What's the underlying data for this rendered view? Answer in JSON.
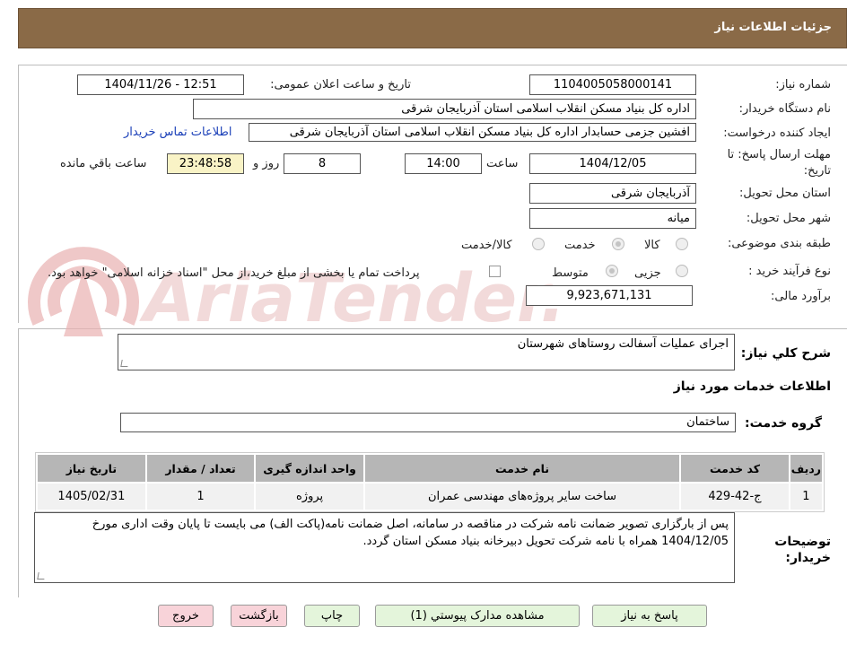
{
  "header": {
    "title": "جزئیات اطلاعات نیاز"
  },
  "watermark": {
    "text": "AriaTender.neT"
  },
  "form": {
    "need_number": {
      "label": "شماره نیاز:",
      "value": "1104005058000141"
    },
    "announce": {
      "label": "تاریخ و ساعت اعلان عمومی:",
      "value": "1404/11/26 - 12:51"
    },
    "buyer_org": {
      "label": "نام دستگاه خریدار:",
      "value": "اداره کل بنیاد مسکن انقلاب اسلامی استان آذربایجان شرقی"
    },
    "creator": {
      "label": "ایجاد کننده درخواست:",
      "value": "افشین جزمی حسابدار اداره کل بنیاد مسکن انقلاب اسلامی استان آذربایجان شرقی",
      "contact_link": "اطلاعات تماس خریدار"
    },
    "deadline": {
      "label_line1": "مهلت ارسال پاسخ: تا",
      "label_line2": "تاریخ:",
      "date": "1404/12/05",
      "time_label": "ساعت",
      "time": "14:00",
      "days": "8",
      "days_label": "روز و",
      "remaining": "23:48:58",
      "remaining_label": "ساعت باقي مانده"
    },
    "province": {
      "label": "استان محل تحویل:",
      "value": "آذربایجان شرقی"
    },
    "city": {
      "label": "شهر محل تحویل:",
      "value": "میانه"
    },
    "category": {
      "label": "طبقه بندی موضوعی:",
      "options": [
        {
          "label": "کالا",
          "selected": false
        },
        {
          "label": "خدمت",
          "selected": true
        },
        {
          "label": "کالا/خدمت",
          "selected": false
        }
      ]
    },
    "process": {
      "label": "نوع فرآیند خرید :",
      "options": [
        {
          "label": "جزیی",
          "selected": false
        },
        {
          "label": "متوسط",
          "selected": true
        }
      ],
      "note": "پرداخت تمام یا بخشی از مبلغ خرید،از محل \"اسناد خزانه اسلامی\" خواهد بود."
    },
    "budget": {
      "label": "برآورد مالی:",
      "value": "9,923,671,131"
    }
  },
  "description": {
    "label": "شرح کلي نياز:",
    "value": "اجرای عملیات آسفالت روستاهای شهرستان"
  },
  "services": {
    "title": "اطلاعات خدمات مورد نیاز",
    "group_label": "گروه خدمت:",
    "group_value": "ساختمان",
    "columns": [
      "ردیف",
      "کد خدمت",
      "نام خدمت",
      "واحد اندازه گیری",
      "تعداد / مقدار",
      "تاریخ نیاز"
    ],
    "rows": [
      [
        "1",
        "ج-42-429",
        "ساخت سایر پروژه‌های مهندسی عمران",
        "پروژه",
        "1",
        "1405/02/31"
      ]
    ]
  },
  "buyer_notes": {
    "label_line1": "توضیحات",
    "label_line2": "خریدار:",
    "value": "پس از بارگزاری تصویر ضمانت نامه شرکت در مناقصه در سامانه، اصل ضمانت نامه(پاکت الف) می بایست تا پایان وقت اداری مورخ 1404/12/05 همراه با نامه شرکت تحویل دبیرخانه بنیاد مسکن استان گردد."
  },
  "buttons": {
    "reply": "پاسخ به نیاز",
    "attachments": "مشاهده مدارک پیوستي (1)",
    "print": "چاپ",
    "back": "بازگشت",
    "exit": "خروج"
  },
  "colors": {
    "header_bg": "#8a6a47",
    "yellow_box": "#f9f3c6",
    "button_green": "#e4f5db",
    "button_pink": "#f8d3d9",
    "link": "#1a3fb8",
    "table_header": "#b6b6b6"
  }
}
